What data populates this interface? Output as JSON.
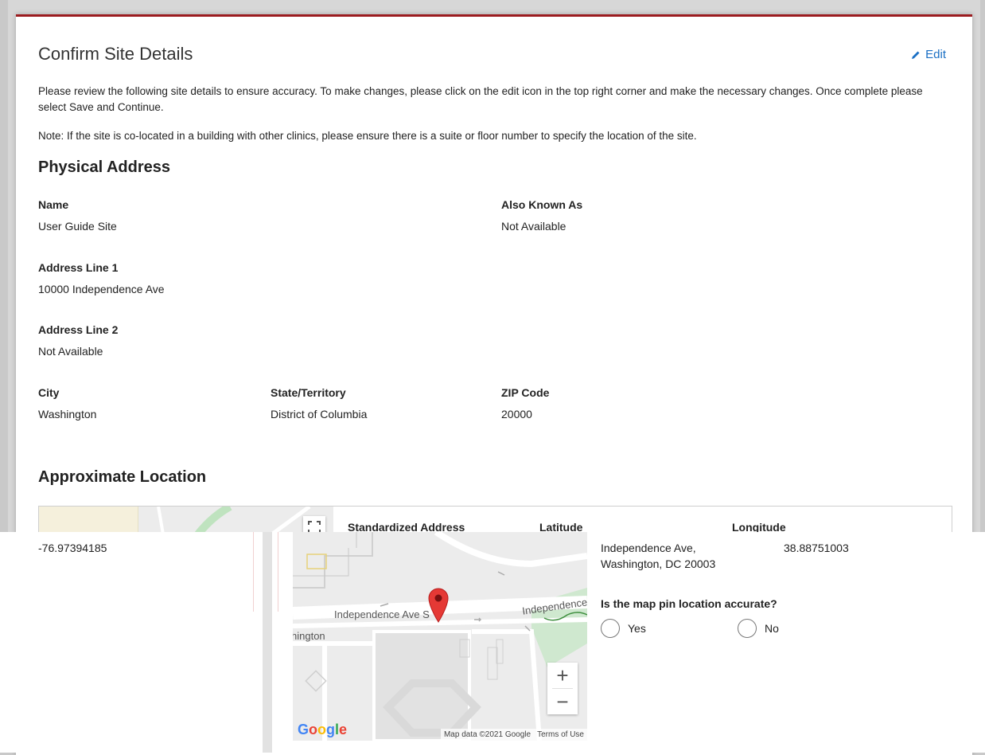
{
  "header": {
    "title": "Confirm Site Details",
    "edit_label": "Edit"
  },
  "intro": {
    "p1": "Please review the following site details to ensure accuracy. To make changes, please click on the edit icon in the top right corner and make the necessary changes. Once complete please select Save and Continue.",
    "p2": "Note: If the site is co-located in a building with other clinics, please ensure there is a suite or floor number to specify the location of the site."
  },
  "physical": {
    "heading": "Physical Address",
    "name_label": "Name",
    "name_value": "User Guide Site",
    "aka_label": "Also Known As",
    "aka_value": "Not Available",
    "addr1_label": "Address Line 1",
    "addr1_value": "10000 Independence Ave",
    "addr2_label": "Address Line 2",
    "addr2_value": "Not Available",
    "city_label": "City",
    "city_value": "Washington",
    "state_label": "State/Territory",
    "state_value": "District of Columbia",
    "zip_label": "ZIP Code",
    "zip_value": "20000"
  },
  "location": {
    "heading": "Approximate Location",
    "std_label": "Standardized Address",
    "lat_label": "Latitude",
    "lng_label": "Longitude",
    "std_line1": "Independence Ave,",
    "std_line2": "Washington, DC 20003",
    "lat_value": "38.88751003",
    "lng_value": "-76.97394185",
    "question": "Is the map pin location accurate?",
    "yes_label": "Yes",
    "no_label": "No"
  },
  "map": {
    "street_label_1": "Independence Ave S",
    "street_label_2": "Independence",
    "city_fragment": "hington",
    "logo": "Google",
    "attribution": "Map data ©2021 Google",
    "terms": "Terms of Use",
    "zoom_in": "+",
    "zoom_out": "−"
  },
  "colors": {
    "accent_red": "#9b1b1f",
    "link_blue": "#1a6fc4",
    "park_green": "#cfe8cf",
    "pin_red": "#e53935"
  }
}
